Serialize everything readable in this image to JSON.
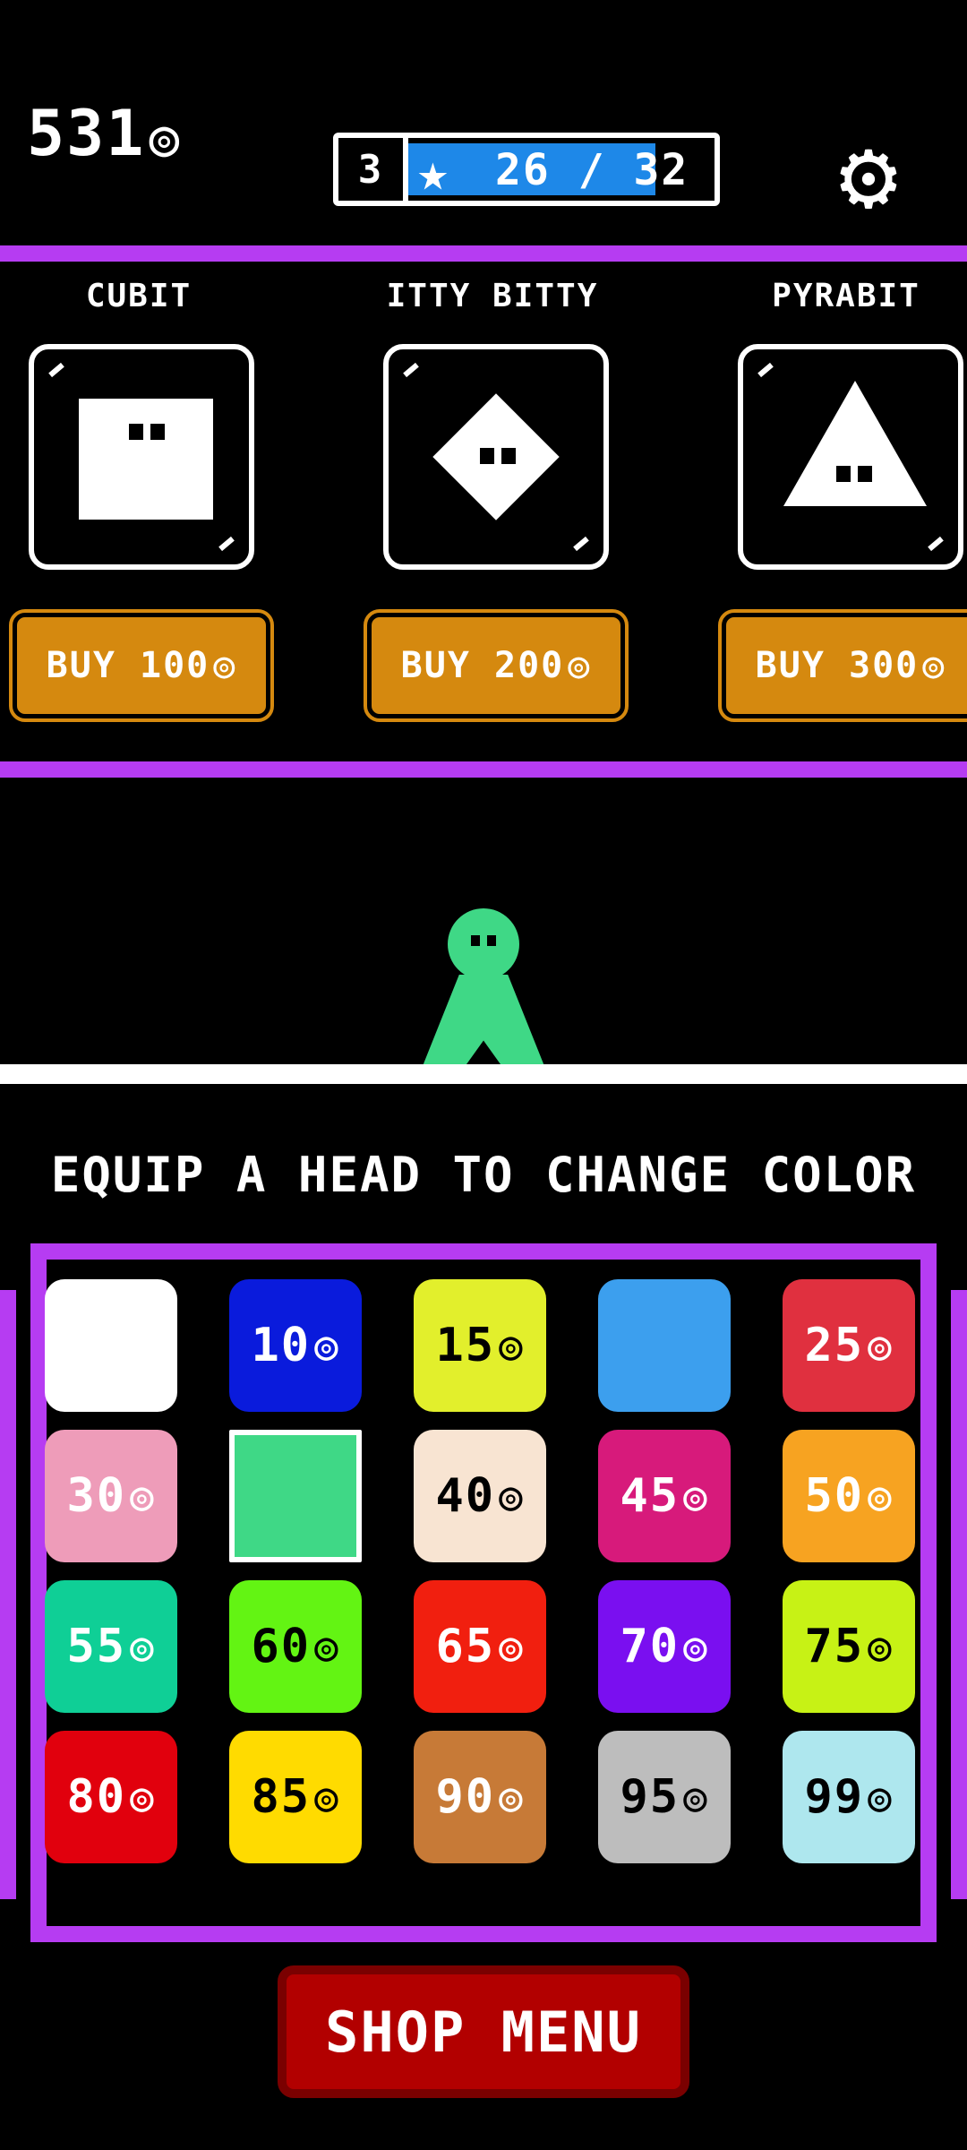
{
  "header": {
    "coins": "531",
    "coin_symbol": "◎",
    "level": "3",
    "xp_text": "26 / 32",
    "xp_progress": 0.8125,
    "star_symbol": "★",
    "settings_symbol": "⚙"
  },
  "characters": [
    {
      "name": "CUBIT",
      "buy_label": "BUY 100",
      "shape": "cube"
    },
    {
      "name": "ITTY BITTY",
      "buy_label": "BUY 200",
      "shape": "diamond"
    },
    {
      "name": "PYRABIT",
      "buy_label": "BUY 300",
      "shape": "triangle"
    }
  ],
  "equip_title": "EQUIP A HEAD TO CHANGE COLOR",
  "colors": [
    {
      "price": "",
      "color": "#ffffff",
      "text": "#000000"
    },
    {
      "price": "10",
      "color": "#0a1bdc",
      "text": "#ffffff"
    },
    {
      "price": "15",
      "color": "#e2ef2c",
      "text": "#000000"
    },
    {
      "price": "",
      "color": "#3c9fee",
      "text": "#ffffff"
    },
    {
      "price": "25",
      "color": "#e0303f",
      "text": "#ffffff"
    },
    {
      "price": "30",
      "color": "#ee9cb9",
      "text": "#ffffff"
    },
    {
      "price": "",
      "color": "#3fd886",
      "text": "#ffffff",
      "selected": true
    },
    {
      "price": "40",
      "color": "#f8e4d2",
      "text": "#000000"
    },
    {
      "price": "45",
      "color": "#d71a7b",
      "text": "#ffffff"
    },
    {
      "price": "50",
      "color": "#f7a321",
      "text": "#ffffff"
    },
    {
      "price": "55",
      "color": "#0fcf96",
      "text": "#ffffff"
    },
    {
      "price": "60",
      "color": "#63f413",
      "text": "#000000"
    },
    {
      "price": "65",
      "color": "#f11f0f",
      "text": "#ffffff"
    },
    {
      "price": "70",
      "color": "#7a0ff0",
      "text": "#ffffff"
    },
    {
      "price": "75",
      "color": "#c7f215",
      "text": "#000000"
    },
    {
      "price": "80",
      "color": "#e1000d",
      "text": "#ffffff"
    },
    {
      "price": "85",
      "color": "#ffdb00",
      "text": "#000000"
    },
    {
      "price": "90",
      "color": "#c77a37",
      "text": "#ffffff"
    },
    {
      "price": "95",
      "color": "#bdbdbd",
      "text": "#000000"
    },
    {
      "price": "99",
      "color": "#aee7ee",
      "text": "#000000"
    }
  ],
  "shop_menu_label": "SHOP MENU",
  "theme": {
    "accent": "#b63cf2",
    "player": "#3fd886",
    "button": "#d5890f",
    "shop_button": "#b20000"
  }
}
